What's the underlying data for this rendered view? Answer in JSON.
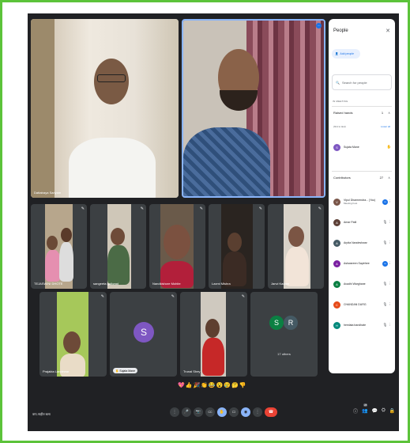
{
  "people_panel": {
    "title": "People",
    "add_people_label": "Add people",
    "search_placeholder": "Search for people",
    "section_in_meeting": "IN MEETING",
    "raised_hands": {
      "label": "Raised hands",
      "count": "1"
    },
    "first_to_last": "(first to last)",
    "lower_all": "Lower all",
    "raised_person": "Sujata Mane",
    "contributors": {
      "label": "Contributors",
      "count": "27"
    },
    "contributor_list": [
      {
        "initial": "V",
        "name": "Vipul Dharmendra... (You)",
        "sub": "Meeting host",
        "color": "#795548",
        "speaking": true
      },
      {
        "initial": "A",
        "name": "Amar Patil",
        "color": "#5d4037",
        "speaking": false
      },
      {
        "initial": "A",
        "name": "Arpita Nandeshwar",
        "color": "#455a64",
        "speaking": false
      },
      {
        "initial": "A",
        "name": "Ashwareen Saptrhee",
        "color": "#7b1fa2",
        "speaking": true
      },
      {
        "initial": "A",
        "name": "Avadhi Warghane",
        "color": "#0b8043",
        "speaking": false
      },
      {
        "initial": "C",
        "name": "CHANDAN DURG",
        "color": "#e64a19",
        "speaking": false
      },
      {
        "initial": "H",
        "name": "hemlata bandhate",
        "color": "#00897b",
        "speaking": false
      }
    ]
  },
  "tiles": {
    "main_left_name": "Dattatraya Sariyam",
    "small": [
      "TEJASWINI DHOTE",
      "sangeeta gaikwad",
      "Nandkishore Mohite",
      "Laxmi Mishra",
      "Janvi Kadam"
    ],
    "bottom": [
      "Prajakta Landewar",
      "Sujata Mane",
      "Trunal Shey",
      "17 others"
    ],
    "sujata_initial": "S",
    "others_initials": [
      "S",
      "R"
    ]
  },
  "reactions": [
    "💖",
    "👍",
    "🎉",
    "👏",
    "😂",
    "😮",
    "😢",
    "🤔",
    "👎"
  ],
  "bottom_bar": {
    "time_label": "वाप-नाहीत बला",
    "controls": [
      "🎤",
      "📷",
      "CC",
      "✋",
      "▭",
      "⋮"
    ],
    "end_call": "☎",
    "right_icons": [
      "ⓘ",
      "👥",
      "💬",
      "⛭",
      "🔒"
    ],
    "participants_badge": "28"
  },
  "colors": {
    "accent": "#1a73e8",
    "frame": "#5cc33a",
    "background": "#202124",
    "end": "#ea4335"
  }
}
